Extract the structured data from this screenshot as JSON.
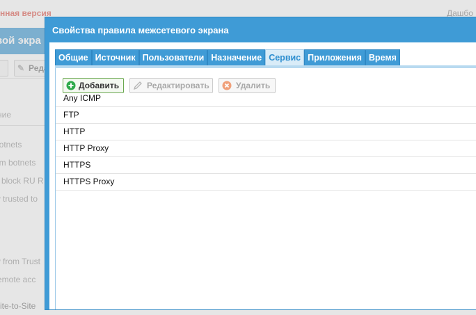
{
  "background": {
    "warning": "нная версия",
    "dashboard": "Дашбо",
    "title": "вой экра",
    "edit_fragment": "Реда",
    "list_header": "ние",
    "rows": [
      "botnets",
      "om botnets",
      "e block RU R",
      "w trusted to",
      "w from Trust",
      "remote acc",
      "Site-to-Site"
    ]
  },
  "dialog": {
    "title": "Свойства правила межсетевого экрана",
    "tabs": [
      {
        "label": "Общие",
        "active": false
      },
      {
        "label": "Источник",
        "active": false
      },
      {
        "label": "Пользователи",
        "active": false
      },
      {
        "label": "Назначение",
        "active": false
      },
      {
        "label": "Сервис",
        "active": true
      },
      {
        "label": "Приложения",
        "active": false
      },
      {
        "label": "Время",
        "active": false
      }
    ],
    "toolbar": {
      "add_label": "Добавить",
      "edit_label": "Редактировать",
      "delete_label": "Удалить"
    },
    "services": [
      "Any ICMP",
      "FTP",
      "HTTP",
      "HTTP Proxy",
      "HTTPS",
      "HTTPS Proxy"
    ]
  },
  "colors": {
    "header_blue": "#3f9bd6",
    "active_tab_text": "#2e8fd0",
    "add_icon_green": "#2eaa4a",
    "delete_icon_orange": "#f0a07a"
  }
}
